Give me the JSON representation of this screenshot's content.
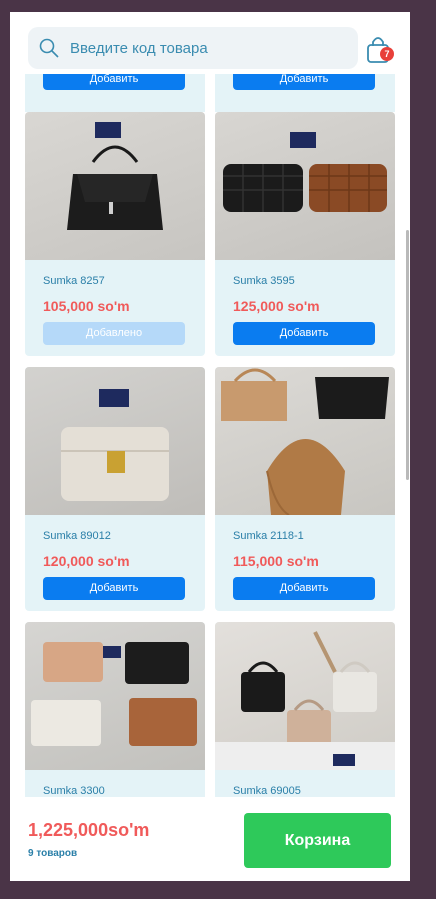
{
  "search": {
    "placeholder": "Введите код товара"
  },
  "cart": {
    "badge": "7"
  },
  "add_label": "Добавить",
  "products": [
    {
      "code": "Sumka 8257",
      "price": "105,000 so'm",
      "button": "Добавлено",
      "state": "added"
    },
    {
      "code": "Sumka 3595",
      "price": "125,000 so'm",
      "button": "Добавить",
      "state": "default"
    },
    {
      "code": "Sumka 89012",
      "price": "120,000 so'm",
      "button": "Добавить",
      "state": "default"
    },
    {
      "code": "Sumka 2118-1",
      "price": "115,000 so'm",
      "button": "Добавить",
      "state": "default"
    },
    {
      "code": "Sumka 3300",
      "price": "",
      "button": "",
      "state": "default"
    },
    {
      "code": "Sumka 69005",
      "price": "",
      "button": "",
      "state": "default"
    }
  ],
  "footer": {
    "total": "1,225,000so'm",
    "count": "9 товаров",
    "checkout_label": "Корзина"
  },
  "colors": {
    "accent": "#0a7cf0",
    "price": "#f05a5a",
    "checkout": "#2ec95a",
    "added": "#b5d9f9"
  }
}
